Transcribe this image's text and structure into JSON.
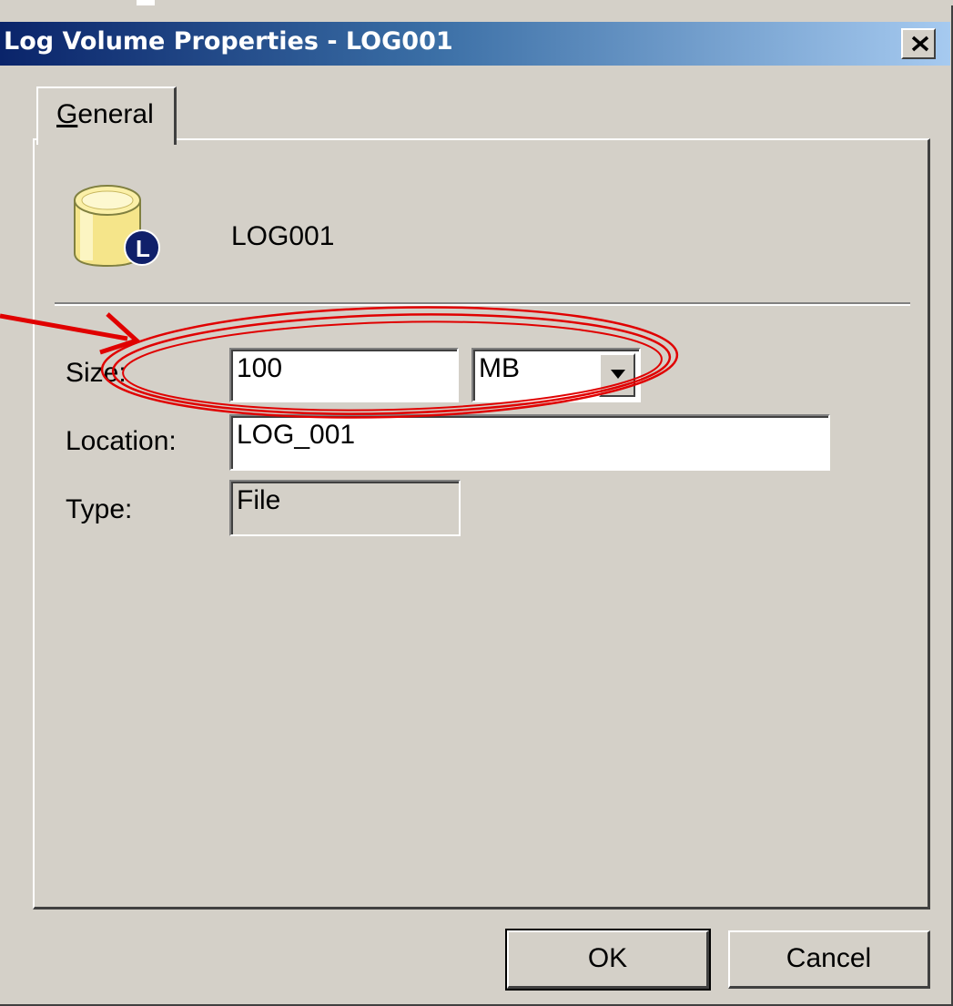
{
  "window": {
    "title": "Log Volume Properties - LOG001",
    "close_label": "×"
  },
  "tabs": [
    {
      "label": "General",
      "accel": "G",
      "active": true
    }
  ],
  "volume": {
    "name": "LOG001",
    "icon": "log-volume-icon",
    "icon_badge": "L"
  },
  "fields": {
    "size": {
      "label": "Size:",
      "value": "100",
      "unit": "MB"
    },
    "location": {
      "label": "Location:",
      "value": "LOG_001"
    },
    "type": {
      "label": "Type:",
      "value": "File"
    }
  },
  "buttons": {
    "ok": "OK",
    "cancel": "Cancel"
  },
  "annotation": {
    "color": "#e00000",
    "description_target": "size-field"
  },
  "colors": {
    "title_start": "#0a246a",
    "title_end": "#a6caf0",
    "face": "#d4d0c8",
    "icon_fill": "#f5e58a",
    "badge": "#10206a"
  }
}
